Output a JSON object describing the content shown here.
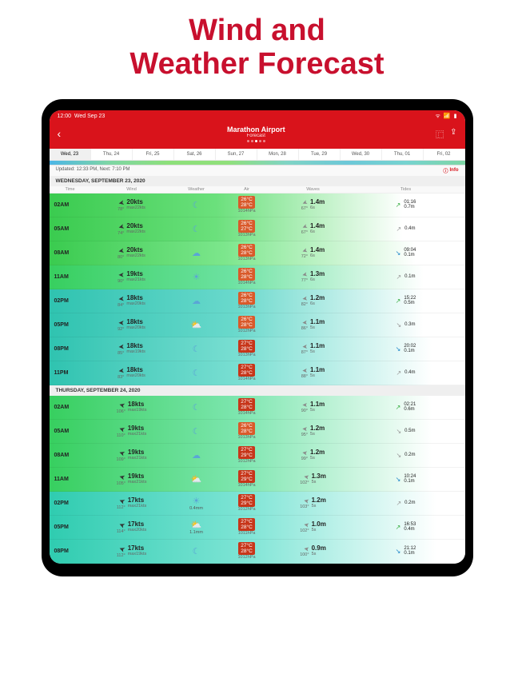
{
  "headline": {
    "line1": "Wind and",
    "line2": "Weather Forecast"
  },
  "status": {
    "time": "12:00",
    "date": "Wed Sep 23"
  },
  "header": {
    "title": "Marathon Airport",
    "subtitle": "Forecast"
  },
  "daytabs": [
    {
      "label": "Wed, 23",
      "active": true
    },
    {
      "label": "Thu, 24"
    },
    {
      "label": "Fri, 25"
    },
    {
      "label": "Sat, 26"
    },
    {
      "label": "Sun, 27"
    },
    {
      "label": "Mon, 28"
    },
    {
      "label": "Tue, 29"
    },
    {
      "label": "Wed, 30"
    },
    {
      "label": "Thu, 01"
    },
    {
      "label": "Fri, 02"
    }
  ],
  "updated": "Updated: 12:33 PM, Next: 7:10 PM",
  "info_label": "Info",
  "columns": {
    "time": "Time",
    "wind": "Wind",
    "weather": "Weather",
    "air": "Air",
    "waves": "Waves",
    "tides": "Tides"
  },
  "sections": [
    {
      "title": "WEDNESDAY, SEPTEMBER 23, 2020",
      "rows": [
        {
          "time": "02AM",
          "bg": "bg-green",
          "wdir": 78,
          "wkts": "20kts",
          "wmax": "max22kts",
          "wicon": "☾",
          "t1": "26°C",
          "t2": "28°C",
          "hpa": "1014hPa",
          "tred": false,
          "wav_dir": 67,
          "wav_h": "1.4m",
          "wav_p": "6s",
          "tide": {
            "style": "up",
            "icon": "↗",
            "time": "01:16",
            "val": "0.7m"
          }
        },
        {
          "time": "05AM",
          "bg": "bg-green",
          "wdir": 74,
          "wkts": "20kts",
          "wmax": "max22kts",
          "wicon": "☾",
          "t1": "26°C",
          "t2": "27°C",
          "hpa": "1013hPa",
          "tred": false,
          "wav_dir": 67,
          "wav_h": "1.4m",
          "wav_p": "6s",
          "tide": {
            "style": "same",
            "icon": "↗",
            "time": "",
            "val": "0.4m"
          }
        },
        {
          "time": "08AM",
          "bg": "bg-green2",
          "wdir": 80,
          "wkts": "20kts",
          "wmax": "max22kts",
          "wicon": "☁",
          "t1": "26°C",
          "t2": "28°C",
          "hpa": "1013hPa",
          "tred": false,
          "wav_dir": 72,
          "wav_h": "1.4m",
          "wav_p": "6s",
          "tide": {
            "style": "down",
            "icon": "↘",
            "time": "09:04",
            "val": "0.1m"
          }
        },
        {
          "time": "11AM",
          "bg": "bg-mint1",
          "wdir": 90,
          "wkts": "19kts",
          "wmax": "max21kts",
          "wicon": "☀",
          "t1": "26°C",
          "t2": "28°C",
          "hpa": "1014hPa",
          "tred": false,
          "wav_dir": 77,
          "wav_h": "1.3m",
          "wav_p": "6s",
          "tide": {
            "style": "same",
            "icon": "↗",
            "time": "",
            "val": "0.1m"
          }
        },
        {
          "time": "02PM",
          "bg": "bg-teal",
          "wdir": 84,
          "wkts": "18kts",
          "wmax": "max20kts",
          "wicon": "☁",
          "t1": "26°C",
          "t2": "28°C",
          "hpa": "1013hPa",
          "tred": false,
          "wav_dir": 82,
          "wav_h": "1.2m",
          "wav_p": "6s",
          "tide": {
            "style": "up",
            "icon": "↗",
            "time": "15:22",
            "val": "0.5m"
          }
        },
        {
          "time": "05PM",
          "bg": "bg-teal",
          "wdir": 92,
          "wkts": "18kts",
          "wmax": "max20kts",
          "wicon": "⛅",
          "t1": "26°C",
          "t2": "28°C",
          "hpa": "1012hPa",
          "tred": false,
          "wav_dir": 86,
          "wav_h": "1.1m",
          "wav_p": "5s",
          "tide": {
            "style": "same",
            "icon": "↘",
            "time": "",
            "val": "0.3m"
          }
        },
        {
          "time": "08PM",
          "bg": "bg-teal2",
          "wdir": 85,
          "wkts": "18kts",
          "wmax": "max19kts",
          "wicon": "☾",
          "t1": "27°C",
          "t2": "28°C",
          "hpa": "1013hPa",
          "tred": true,
          "wav_dir": 87,
          "wav_h": "1.1m",
          "wav_p": "5s",
          "tide": {
            "style": "down",
            "icon": "↘",
            "time": "20:02",
            "val": "0.1m"
          }
        },
        {
          "time": "11PM",
          "bg": "bg-teal2",
          "wdir": 83,
          "wkts": "18kts",
          "wmax": "max20kts",
          "wicon": "☾",
          "t1": "27°C",
          "t2": "28°C",
          "hpa": "1014hPa",
          "tred": true,
          "wav_dir": 88,
          "wav_h": "1.1m",
          "wav_p": "5s",
          "tide": {
            "style": "same",
            "icon": "↗",
            "time": "",
            "val": "0.4m"
          }
        }
      ]
    },
    {
      "title": "THURSDAY, SEPTEMBER 24, 2020",
      "rows": [
        {
          "time": "02AM",
          "bg": "bg-mint2",
          "wdir": 106,
          "wkts": "18kts",
          "wmax": "max19kts",
          "wicon": "☾",
          "t1": "27°C",
          "t2": "28°C",
          "hpa": "1014hPa",
          "tred": true,
          "wav_dir": 90,
          "wav_h": "1.1m",
          "wav_p": "5s",
          "tide": {
            "style": "up",
            "icon": "↗",
            "time": "02:21",
            "val": "0.6m"
          }
        },
        {
          "time": "05AM",
          "bg": "bg-mint2",
          "wdir": 110,
          "wkts": "19kts",
          "wmax": "max21kts",
          "wicon": "☾",
          "t1": "26°C",
          "t2": "28°C",
          "hpa": "1013hPa",
          "tred": false,
          "wav_dir": 95,
          "wav_h": "1.2m",
          "wav_p": "5s",
          "tide": {
            "style": "same",
            "icon": "↘",
            "time": "",
            "val": "0.5m"
          }
        },
        {
          "time": "08AM",
          "bg": "bg-mint2",
          "wdir": 109,
          "wkts": "19kts",
          "wmax": "max21kts",
          "wicon": "☁",
          "t1": "27°C",
          "t2": "29°C",
          "hpa": "1012hPa",
          "tred": true,
          "wav_dir": 99,
          "wav_h": "1.2m",
          "wav_p": "5s",
          "tide": {
            "style": "same",
            "icon": "↘",
            "time": "",
            "val": "0.2m"
          }
        },
        {
          "time": "11AM",
          "bg": "bg-mint2",
          "wdir": 105,
          "wkts": "19kts",
          "wmax": "max21kts",
          "wicon": "⛅",
          "t1": "27°C",
          "t2": "29°C",
          "hpa": "1014hPa",
          "tred": true,
          "wav_dir": 102,
          "wav_h": "1.3m",
          "wav_p": "5s",
          "tide": {
            "style": "down",
            "icon": "↘",
            "time": "10:24",
            "val": "0.1m"
          }
        },
        {
          "time": "02PM",
          "bg": "bg-mint3",
          "wdir": 112,
          "wkts": "17kts",
          "wmax": "max21kts",
          "wicon": "☀",
          "rain": "0.4mm",
          "t1": "27°C",
          "t2": "29°C",
          "hpa": "1012hPa",
          "tred": true,
          "wav_dir": 103,
          "wav_h": "1.2m",
          "wav_p": "5s",
          "tide": {
            "style": "same",
            "icon": "↗",
            "time": "",
            "val": "0.2m"
          }
        },
        {
          "time": "05PM",
          "bg": "bg-mint3",
          "wdir": 114,
          "wkts": "17kts",
          "wmax": "max20kts",
          "wicon": "⛅",
          "rain": "1.1mm",
          "t1": "27°C",
          "t2": "28°C",
          "hpa": "1011hPa",
          "tred": true,
          "wav_dir": 102,
          "wav_h": "1.0m",
          "wav_p": "5s",
          "tide": {
            "style": "up",
            "icon": "↗",
            "time": "16:53",
            "val": "0.4m"
          }
        },
        {
          "time": "08PM",
          "bg": "bg-mint3",
          "wdir": 112,
          "wkts": "17kts",
          "wmax": "max19kts",
          "wicon": "☾",
          "t1": "27°C",
          "t2": "28°C",
          "hpa": "1012hPa",
          "tred": true,
          "wav_dir": 100,
          "wav_h": "0.9m",
          "wav_p": "5s",
          "tide": {
            "style": "down",
            "icon": "↘",
            "time": "21:12",
            "val": "0.1m"
          }
        }
      ]
    }
  ]
}
